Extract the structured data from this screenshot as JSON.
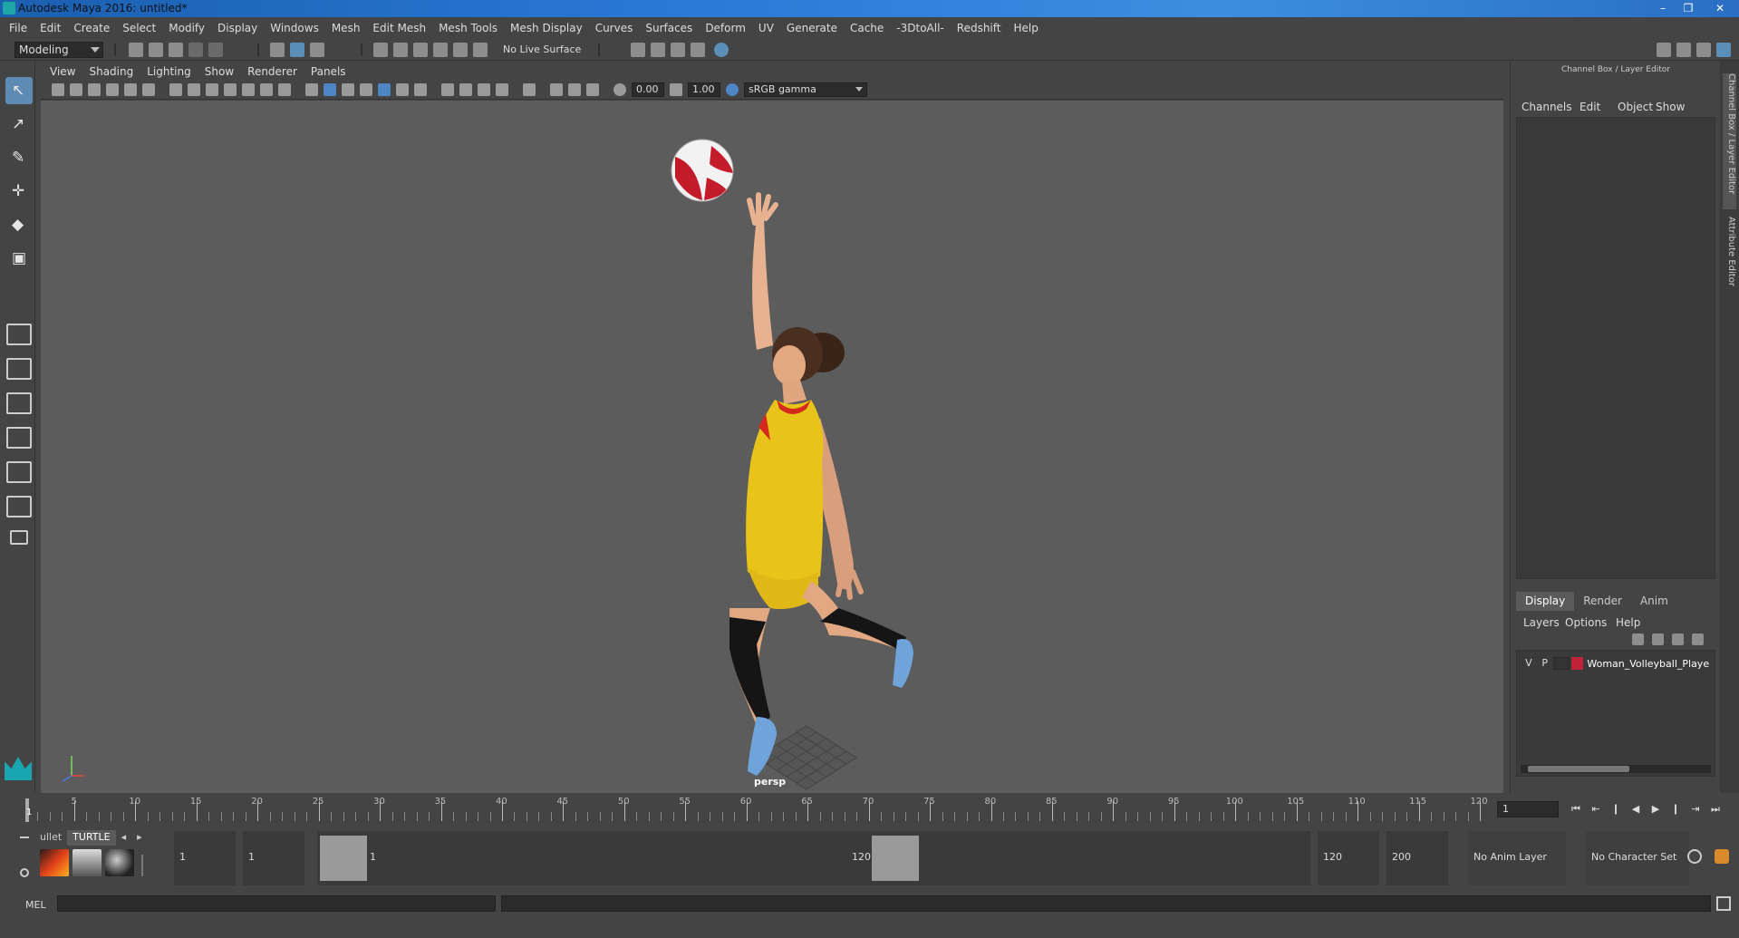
{
  "window": {
    "title": "Autodesk Maya 2016: untitled*",
    "minimize": "–",
    "restore": "❐",
    "close": "✕"
  },
  "menubar": [
    "File",
    "Edit",
    "Create",
    "Select",
    "Modify",
    "Display",
    "Windows",
    "Mesh",
    "Edit Mesh",
    "Mesh Tools",
    "Mesh Display",
    "Curves",
    "Surfaces",
    "Deform",
    "UV",
    "Generate",
    "Cache",
    "-3DtoAll-",
    "Redshift",
    "Help"
  ],
  "statusline": {
    "mode": "Modeling",
    "live_surface": "No Live Surface"
  },
  "viewport": {
    "menus": [
      "View",
      "Shading",
      "Lighting",
      "Show",
      "Renderer",
      "Panels"
    ],
    "exposure": "0.00",
    "gamma": "1.00",
    "color_space": "sRGB gamma",
    "camera_label": "persp"
  },
  "channel_box": {
    "header": "Channel Box / Layer Editor",
    "menus": [
      "Channels",
      "Edit",
      "Object",
      "Show"
    ],
    "side_tab_1": "Channel Box / Layer Editor",
    "side_tab_2": "Attribute Editor"
  },
  "layer_editor": {
    "tabs": [
      "Display",
      "Render",
      "Anim"
    ],
    "active_tab": "Display",
    "menus": [
      "Layers",
      "Options",
      "Help"
    ],
    "layer": {
      "visible": "V",
      "playback": "P",
      "name": "Woman_Volleyball_Playe",
      "color": "#c0223a"
    }
  },
  "time_slider": {
    "current_frame": "1",
    "tick_labels": [
      "5",
      "10",
      "15",
      "20",
      "25",
      "30",
      "35",
      "40",
      "45",
      "50",
      "55",
      "60",
      "65",
      "70",
      "75",
      "80",
      "85",
      "90",
      "95",
      "100",
      "105",
      "110",
      "115",
      "120"
    ],
    "frame_field": "1"
  },
  "range_slider": {
    "shelf_tabs": [
      "ullet",
      "TURTLE"
    ],
    "start_time": "1",
    "playback_start": "1",
    "range_start_label": "1",
    "range_end_label": "120",
    "playback_end": "120",
    "end_time": "200",
    "anim_layer": "No Anim Layer",
    "character_set": "No Character Set"
  },
  "command_line": {
    "label": "MEL"
  },
  "colors": {
    "ui_bg": "#444444",
    "viewport_bg": "#5c5c5c",
    "highlight": "#5d8bb3",
    "jersey": "#e8c41a"
  }
}
